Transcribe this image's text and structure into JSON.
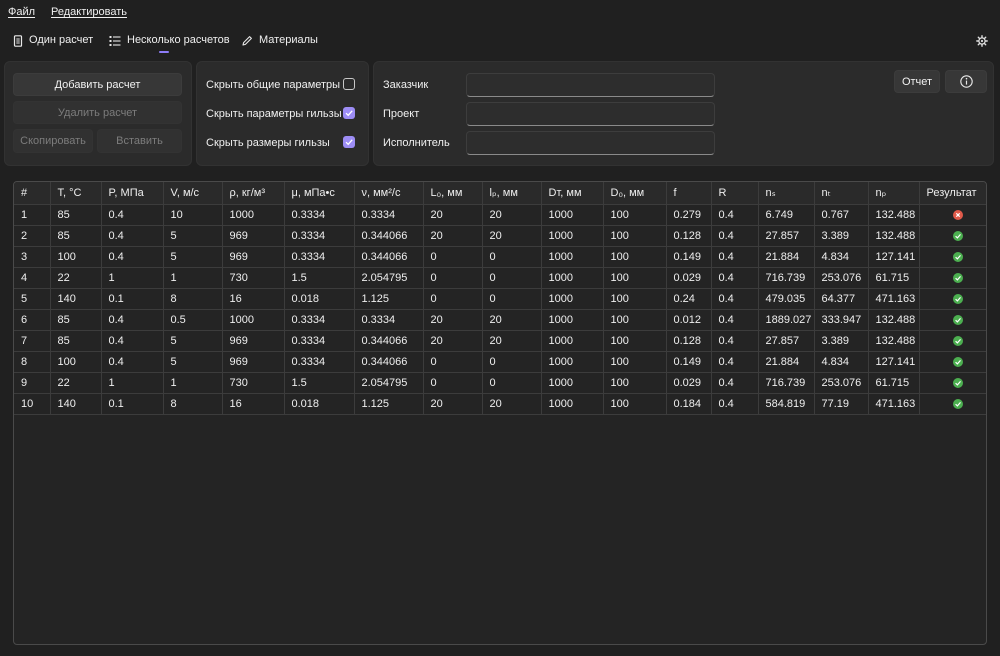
{
  "menu": {
    "file": "Файл",
    "edit": "Редактировать"
  },
  "nav": {
    "single": "Один расчет",
    "multiple": "Несколько расчетов",
    "materials": "Материалы",
    "active_tab": "multiple"
  },
  "actions": {
    "add": "Добавить расчет",
    "delete": "Удалить расчет",
    "copy": "Скопировать",
    "paste": "Вставить"
  },
  "toggles": [
    {
      "label": "Скрыть общие параметры",
      "checked": false
    },
    {
      "label": "Скрыть параметры гильзы",
      "checked": true
    },
    {
      "label": "Скрыть размеры гильзы",
      "checked": true
    }
  ],
  "fields": {
    "customer_label": "Заказчик",
    "customer_value": "",
    "project_label": "Проект",
    "project_value": "",
    "executor_label": "Исполнитель",
    "executor_value": ""
  },
  "report": {
    "button": "Отчет",
    "info_icon": "info-icon"
  },
  "colors": {
    "accent": "#8d7cf7",
    "success": "#4caf50",
    "error": "#e05a4a",
    "background": "#202020"
  },
  "table": {
    "columns": [
      "#",
      "T, °C",
      "P, МПа",
      "V, м/с",
      "ρ, кг/м³",
      "μ, мПа•с",
      "ν, мм²/с",
      "L₀, мм",
      "lₚ, мм",
      "Dт, мм",
      "D₀, мм",
      "f",
      "R",
      "nₛ",
      "nₜ",
      "nₚ",
      "Результат"
    ],
    "rows": [
      {
        "cells": [
          "1",
          "85",
          "0.4",
          "10",
          "1000",
          "0.3334",
          "0.3334",
          "20",
          "20",
          "1000",
          "100",
          "0.279",
          "0.4",
          "6.749",
          "0.767",
          "132.488"
        ],
        "result": "error"
      },
      {
        "cells": [
          "2",
          "85",
          "0.4",
          "5",
          "969",
          "0.3334",
          "0.344066",
          "20",
          "20",
          "1000",
          "100",
          "0.128",
          "0.4",
          "27.857",
          "3.389",
          "132.488"
        ],
        "result": "ok"
      },
      {
        "cells": [
          "3",
          "100",
          "0.4",
          "5",
          "969",
          "0.3334",
          "0.344066",
          "0",
          "0",
          "1000",
          "100",
          "0.149",
          "0.4",
          "21.884",
          "4.834",
          "127.141"
        ],
        "result": "ok"
      },
      {
        "cells": [
          "4",
          "22",
          "1",
          "1",
          "730",
          "1.5",
          "2.054795",
          "0",
          "0",
          "1000",
          "100",
          "0.029",
          "0.4",
          "716.739",
          "253.076",
          "61.715"
        ],
        "result": "ok"
      },
      {
        "cells": [
          "5",
          "140",
          "0.1",
          "8",
          "16",
          "0.018",
          "1.125",
          "0",
          "0",
          "1000",
          "100",
          "0.24",
          "0.4",
          "479.035",
          "64.377",
          "471.163"
        ],
        "result": "ok"
      },
      {
        "cells": [
          "6",
          "85",
          "0.4",
          "0.5",
          "1000",
          "0.3334",
          "0.3334",
          "20",
          "20",
          "1000",
          "100",
          "0.012",
          "0.4",
          "1889.027",
          "333.947",
          "132.488"
        ],
        "result": "ok"
      },
      {
        "cells": [
          "7",
          "85",
          "0.4",
          "5",
          "969",
          "0.3334",
          "0.344066",
          "20",
          "20",
          "1000",
          "100",
          "0.128",
          "0.4",
          "27.857",
          "3.389",
          "132.488"
        ],
        "result": "ok"
      },
      {
        "cells": [
          "8",
          "100",
          "0.4",
          "5",
          "969",
          "0.3334",
          "0.344066",
          "0",
          "0",
          "1000",
          "100",
          "0.149",
          "0.4",
          "21.884",
          "4.834",
          "127.141"
        ],
        "result": "ok"
      },
      {
        "cells": [
          "9",
          "22",
          "1",
          "1",
          "730",
          "1.5",
          "2.054795",
          "0",
          "0",
          "1000",
          "100",
          "0.029",
          "0.4",
          "716.739",
          "253.076",
          "61.715"
        ],
        "result": "ok"
      },
      {
        "cells": [
          "10",
          "140",
          "0.1",
          "8",
          "16",
          "0.018",
          "1.125",
          "20",
          "20",
          "1000",
          "100",
          "0.184",
          "0.4",
          "584.819",
          "77.19",
          "471.163"
        ],
        "result": "ok"
      }
    ]
  }
}
